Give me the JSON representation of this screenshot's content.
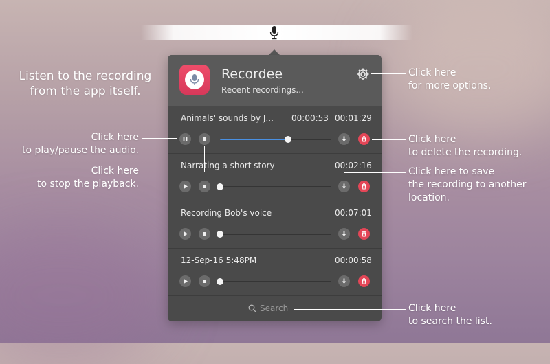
{
  "app": {
    "title": "Recordee",
    "subtitle": "Recent recordings..."
  },
  "recordings": [
    {
      "name": "Animals' sounds by J...",
      "elapsed": "00:00:53",
      "duration": "00:01:29",
      "progress": 0.61,
      "playing": true
    },
    {
      "name": "Narrating a short story",
      "elapsed": "",
      "duration": "00:02:16",
      "progress": 0,
      "playing": false
    },
    {
      "name": "Recording Bob's voice",
      "elapsed": "",
      "duration": "00:07:01",
      "progress": 0,
      "playing": false
    },
    {
      "name": "12-Sep-16  5:48PM",
      "elapsed": "",
      "duration": "00:00:58",
      "progress": 0,
      "playing": false
    }
  ],
  "search": {
    "label": "Search"
  },
  "callouts": {
    "listen": "Listen to the recording\nfrom the app itself.",
    "options": "Click here\nfor more options.",
    "play_pause": "Click here\nto play/pause the audio.",
    "stop": "Click here\nto stop the playback.",
    "delete": "Click here\nto delete the recording.",
    "save": "Click here to save\nthe recording to another\nlocation.",
    "search": "Click here\nto search the list."
  },
  "colors": {
    "accent": "#4a90e2",
    "delete": "#e44657",
    "brand": "#e2476a"
  },
  "icons": [
    "microphone-icon",
    "gear-icon",
    "play-icon",
    "pause-icon",
    "stop-icon",
    "download-icon",
    "trash-icon",
    "search-icon"
  ]
}
